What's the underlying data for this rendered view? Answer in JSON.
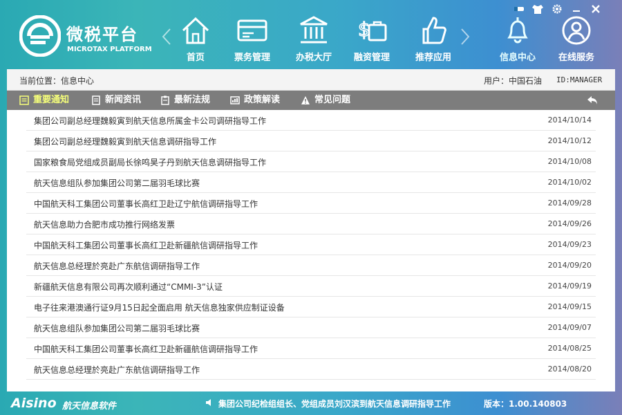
{
  "brand": {
    "name_cn": "微税平台",
    "name_en": "MICROTAX PLATFORM"
  },
  "nav": {
    "items": [
      {
        "label": "首页",
        "icon": "home-icon"
      },
      {
        "label": "票务管理",
        "icon": "ticket-icon"
      },
      {
        "label": "办税大厅",
        "icon": "tax-hall-icon"
      },
      {
        "label": "融资管理",
        "icon": "finance-icon"
      },
      {
        "label": "推荐应用",
        "icon": "thumbs-up-icon"
      },
      {
        "label": "信息中心",
        "icon": "bell-icon"
      },
      {
        "label": "在线服务",
        "icon": "user-service-icon"
      }
    ],
    "active": "信息中心"
  },
  "location": {
    "text": "当前位置：信息中心"
  },
  "user": {
    "text": "用户：中国石油",
    "id": "ID:MANAGER"
  },
  "tabs": [
    {
      "label": "重要通知",
      "icon": "notice-icon"
    },
    {
      "label": "新闻资讯",
      "icon": "news-icon"
    },
    {
      "label": "最新法规",
      "icon": "regulation-icon"
    },
    {
      "label": "政策解读",
      "icon": "policy-icon"
    },
    {
      "label": "常见问题",
      "icon": "warning-icon"
    }
  ],
  "news": [
    {
      "title": "集团公司副总经理魏毅寅到航天信息所属金卡公司调研指导工作",
      "date": "2014/10/14"
    },
    {
      "title": "集团公司副总经理魏毅寅到航天信息调研指导工作",
      "date": "2014/10/12"
    },
    {
      "title": "国家粮食局党组成员副局长徐鸣昊子丹到航天信息调研指导工作",
      "date": "2014/10/08"
    },
    {
      "title": "航天信息组队参加集团公司第二届羽毛球比赛",
      "date": "2014/10/02"
    },
    {
      "title": "中国航天科工集团公司董事长高红卫赴辽宁航信调研指导工作",
      "date": "2014/09/28"
    },
    {
      "title": "航天信息助力合肥市成功推行网络发票",
      "date": "2014/09/26"
    },
    {
      "title": "中国航天科工集团公司董事长高红卫赴新疆航信调研指导工作",
      "date": "2014/09/23"
    },
    {
      "title": "航天信息总经理於亮赴广东航信调研指导工作",
      "date": "2014/09/20"
    },
    {
      "title": "新疆航天信息有限公司再次顺利通过“CMMI-3”认证",
      "date": "2014/09/19"
    },
    {
      "title": "电子往来港澳通行证9月15日起全面启用 航天信息独家供应制证设备",
      "date": "2014/09/15"
    },
    {
      "title": "航天信息组队参加集团公司第二届羽毛球比赛",
      "date": "2014/09/07"
    },
    {
      "title": "中国航天科工集团公司董事长高红卫赴新疆航信调研指导工作",
      "date": "2014/08/25"
    },
    {
      "title": "航天信息总经理於亮赴广东航信调研指导工作",
      "date": "2014/08/20"
    }
  ],
  "footer": {
    "logo": "Aisino",
    "logo_cn": "航天信息软件",
    "ticker": "集团公司纪检组组长、党组成员刘汉滨到航天信息调研指导工作",
    "version": "版本：1.00.140803"
  },
  "colors": {
    "tab_bar": "#7d7d7d",
    "active_tab": "#f6ff7a",
    "panel_bg": "#ffffff"
  }
}
